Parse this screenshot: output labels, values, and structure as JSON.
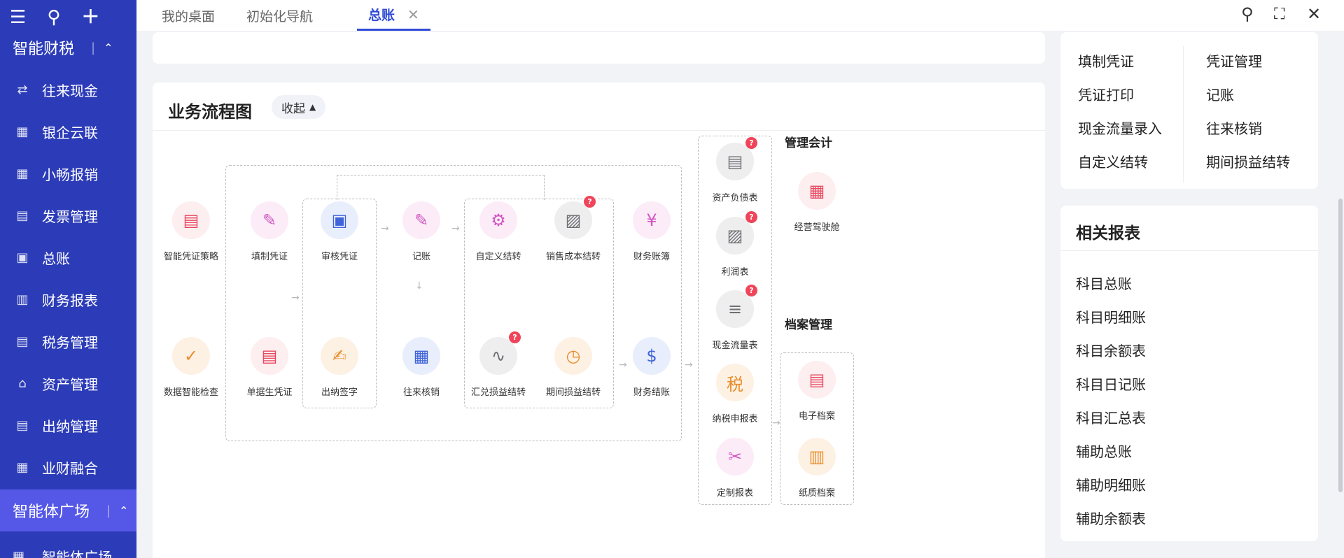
{
  "sidebar": {
    "top_icons": [
      "menu-icon",
      "search-icon",
      "plus-icon"
    ],
    "section_top": "智能财税",
    "items": [
      {
        "label": "往来现金",
        "icon": "⇄"
      },
      {
        "label": "银企云联",
        "icon": "▦"
      },
      {
        "label": "小畅报销",
        "icon": "▦"
      },
      {
        "label": "发票管理",
        "icon": "▤"
      },
      {
        "label": "总账",
        "icon": "▣"
      },
      {
        "label": "财务报表",
        "icon": "▥"
      },
      {
        "label": "税务管理",
        "icon": "▤"
      },
      {
        "label": "资产管理",
        "icon": "⌂"
      },
      {
        "label": "出纳管理",
        "icon": "▤"
      },
      {
        "label": "业财融合",
        "icon": "▦"
      }
    ],
    "section_agent": "智能体广场",
    "agent_item": "智能体广场"
  },
  "tabs": [
    {
      "label": "我的桌面"
    },
    {
      "label": "初始化导航"
    },
    {
      "label": "总账",
      "active": true
    }
  ],
  "flow": {
    "title": "业务流程图",
    "collapse": "收起",
    "nodes": {
      "smart_voucher": "智能凭证策略",
      "fill_voucher": "填制凭证",
      "audit_voucher": "审核凭证",
      "bookkeeping": "记账",
      "custom_carry": "自定义结转",
      "cost_carry": "销售成本结转",
      "fin_books": "财务账簿",
      "data_check": "数据智能检查",
      "doc_voucher": "单据生凭证",
      "cashier_sign": "出纳签字",
      "ar_ap_verify": "往来核销",
      "fx_carry": "汇兑损益结转",
      "period_carry": "期间损益结转",
      "fin_close": "财务结账",
      "balance_sheet": "资产负债表",
      "income_stmt": "利润表",
      "cashflow_stmt": "现金流量表",
      "tax_report": "纳税申报表",
      "custom_report": "定制报表",
      "mgmt_cockpit": "经营驾驶舱",
      "e_archive": "电子档案",
      "paper_archive": "纸质档案"
    },
    "groups": {
      "mgmt_accounting": "管理会计",
      "archive_mgmt": "档案管理"
    },
    "help_mark": "?"
  },
  "quick_links": [
    "填制凭证",
    "凭证管理",
    "凭证打印",
    "记账",
    "现金流量录入",
    "往来核销",
    "自定义结转",
    "期间损益结转"
  ],
  "reports": {
    "title": "相关报表",
    "items": [
      "科目总账",
      "科目明细账",
      "科目余额表",
      "科目日记账",
      "科目汇总表",
      "辅助总账",
      "辅助明细账",
      "辅助余额表"
    ]
  },
  "colors": {
    "sidebar": "#2c3cb8",
    "accent": "#2f4bd6",
    "badge": "#f0445a"
  }
}
